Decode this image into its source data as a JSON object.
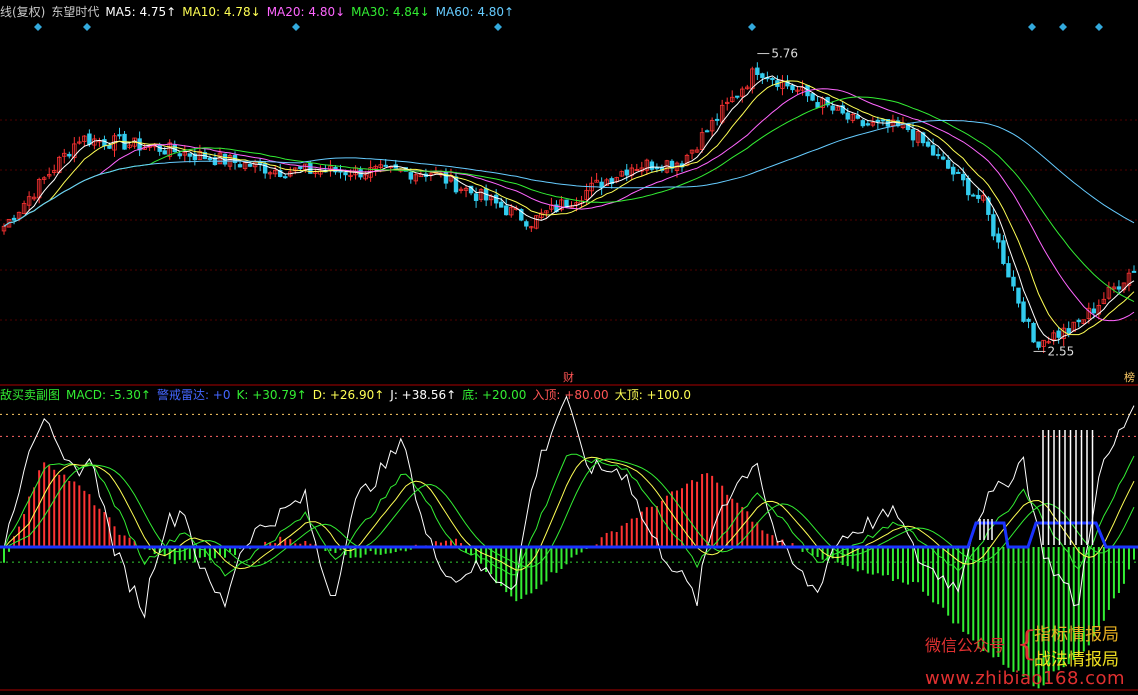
{
  "top_legend": [
    {
      "text": "线(复权)",
      "color": "#c8c8c8"
    },
    {
      "text": "东望时代",
      "color": "#c8c8c8"
    },
    {
      "text": "MA5: 4.75↑",
      "color": "#ffffff"
    },
    {
      "text": "MA10: 4.78↓",
      "color": "#ffff55"
    },
    {
      "text": "MA20: 4.80↓",
      "color": "#ff66ff"
    },
    {
      "text": "MA30: 4.84↓",
      "color": "#33ee33"
    },
    {
      "text": "MA60: 4.80↑",
      "color": "#66ccff"
    }
  ],
  "bottom_legend": [
    {
      "text": "敌买卖副图",
      "color": "#33ee33"
    },
    {
      "text": "MACD: -5.30↑",
      "color": "#33ee33"
    },
    {
      "text": "警戒雷达: +0",
      "color": "#4466ff"
    },
    {
      "text": "K: +30.79↑",
      "color": "#33ee33"
    },
    {
      "text": "D: +26.90↑",
      "color": "#ffff55"
    },
    {
      "text": "J: +38.56↑",
      "color": "#ffffff"
    },
    {
      "text": "底: +20.00",
      "color": "#33ee33"
    },
    {
      "text": "入顶: +80.00",
      "color": "#ff5555"
    },
    {
      "text": "大顶: +100.0",
      "color": "#ffff55"
    }
  ],
  "markers": {
    "high_label": "5.76",
    "low_label": "2.55",
    "cai_label": "财",
    "bang_label": "榜"
  },
  "watermark": {
    "wechat": "微信公众号",
    "brace": "{",
    "name1": "指标情报局",
    "name2": "战法情报局",
    "url": "www.zhibiao168.com"
  },
  "colors": {
    "up": "#ff3333",
    "down": "#33ccee",
    "ma5": "#ffffff",
    "ma10": "#ffff55",
    "ma20": "#ff66ff",
    "ma30": "#33ee33",
    "ma60": "#66ccff",
    "macd_pos": "#ff3333",
    "macd_neg": "#33ee33",
    "radar": "#1a33ff",
    "divider": "#aa0000",
    "diamond": "#33aadd"
  },
  "chart_data": [
    {
      "type": "candlestick",
      "price_key_points": [
        {
          "i": 0,
          "p": 3.9
        },
        {
          "i": 15,
          "p": 4.85
        },
        {
          "i": 30,
          "p": 4.75
        },
        {
          "i": 55,
          "p": 4.5
        },
        {
          "i": 85,
          "p": 4.48
        },
        {
          "i": 105,
          "p": 3.95
        },
        {
          "i": 125,
          "p": 4.55
        },
        {
          "i": 135,
          "p": 4.6
        },
        {
          "i": 150,
          "p": 5.6
        },
        {
          "i": 170,
          "p": 5.0
        },
        {
          "i": 180,
          "p": 4.95
        },
        {
          "i": 195,
          "p": 4.15
        },
        {
          "i": 205,
          "p": 2.65
        },
        {
          "i": 213,
          "p": 2.8
        },
        {
          "i": 225,
          "p": 3.45
        }
      ],
      "bar_count": 226,
      "high_point": 5.76,
      "low_point": 2.55,
      "ylim": [
        2.35,
        6.1
      ]
    },
    {
      "type": "line",
      "indicator": "KDJ",
      "k_key_points": [
        {
          "i": 0,
          "v": 30
        },
        {
          "i": 8,
          "v": 80
        },
        {
          "i": 18,
          "v": 82
        },
        {
          "i": 28,
          "v": 20
        },
        {
          "i": 36,
          "v": 40
        },
        {
          "i": 44,
          "v": 12
        },
        {
          "i": 60,
          "v": 50
        },
        {
          "i": 66,
          "v": 22
        },
        {
          "i": 80,
          "v": 78
        },
        {
          "i": 90,
          "v": 30
        },
        {
          "i": 102,
          "v": 12
        },
        {
          "i": 112,
          "v": 88
        },
        {
          "i": 124,
          "v": 80
        },
        {
          "i": 138,
          "v": 18
        },
        {
          "i": 150,
          "v": 65
        },
        {
          "i": 162,
          "v": 20
        },
        {
          "i": 178,
          "v": 45
        },
        {
          "i": 190,
          "v": 15
        },
        {
          "i": 203,
          "v": 66
        },
        {
          "i": 214,
          "v": 15
        },
        {
          "i": 225,
          "v": 88
        }
      ],
      "levels": {
        "bottom": 20,
        "top": 80,
        "big_top": 100
      },
      "ylim": [
        -55,
        120
      ]
    },
    {
      "type": "bar",
      "indicator": "MACD",
      "key_points": [
        {
          "i": 0,
          "v": -5
        },
        {
          "i": 8,
          "v": 28
        },
        {
          "i": 16,
          "v": 18
        },
        {
          "i": 24,
          "v": 3
        },
        {
          "i": 34,
          "v": -5
        },
        {
          "i": 44,
          "v": -3
        },
        {
          "i": 56,
          "v": 3
        },
        {
          "i": 70,
          "v": -3
        },
        {
          "i": 90,
          "v": 2
        },
        {
          "i": 102,
          "v": -18
        },
        {
          "i": 112,
          "v": -5
        },
        {
          "i": 124,
          "v": 8
        },
        {
          "i": 140,
          "v": 24
        },
        {
          "i": 152,
          "v": 4
        },
        {
          "i": 170,
          "v": -8
        },
        {
          "i": 182,
          "v": -12
        },
        {
          "i": 194,
          "v": -32
        },
        {
          "i": 206,
          "v": -45
        },
        {
          "i": 216,
          "v": -32
        },
        {
          "i": 225,
          "v": -5
        }
      ]
    }
  ]
}
